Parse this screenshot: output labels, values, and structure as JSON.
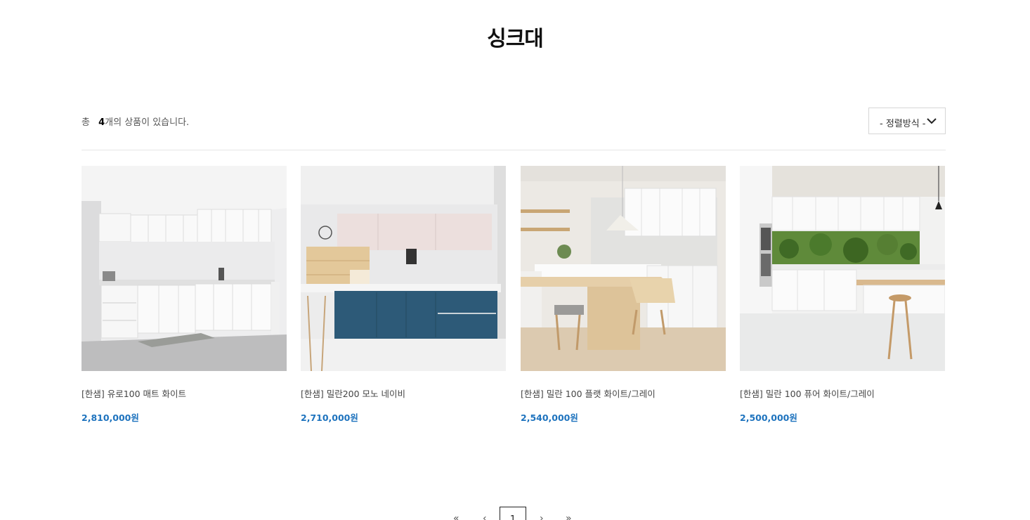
{
  "page": {
    "title": "싱크대"
  },
  "toolbar": {
    "count_prefix": "총",
    "count_value": "4",
    "count_suffix": "개의 상품이 있습니다.",
    "sort_label": "- 정렬방식 -"
  },
  "products": [
    {
      "name": "[한샘] 유로100 매트 화이트",
      "price": "2,810,000원"
    },
    {
      "name": "[한샘] 밀란200 모노 네이비",
      "price": "2,710,000원"
    },
    {
      "name": "[한샘] 밀란 100 플랫 화이트/그레이",
      "price": "2,540,000원"
    },
    {
      "name": "[한샘] 밀란 100 퓨어 화이트/그레이",
      "price": "2,500,000원"
    }
  ],
  "pagination": {
    "first": "«",
    "prev": "‹",
    "current": "1",
    "next": "›",
    "last": "»"
  },
  "colors": {
    "price": "#1e73be",
    "navy_cabinet": "#2d5a78"
  }
}
